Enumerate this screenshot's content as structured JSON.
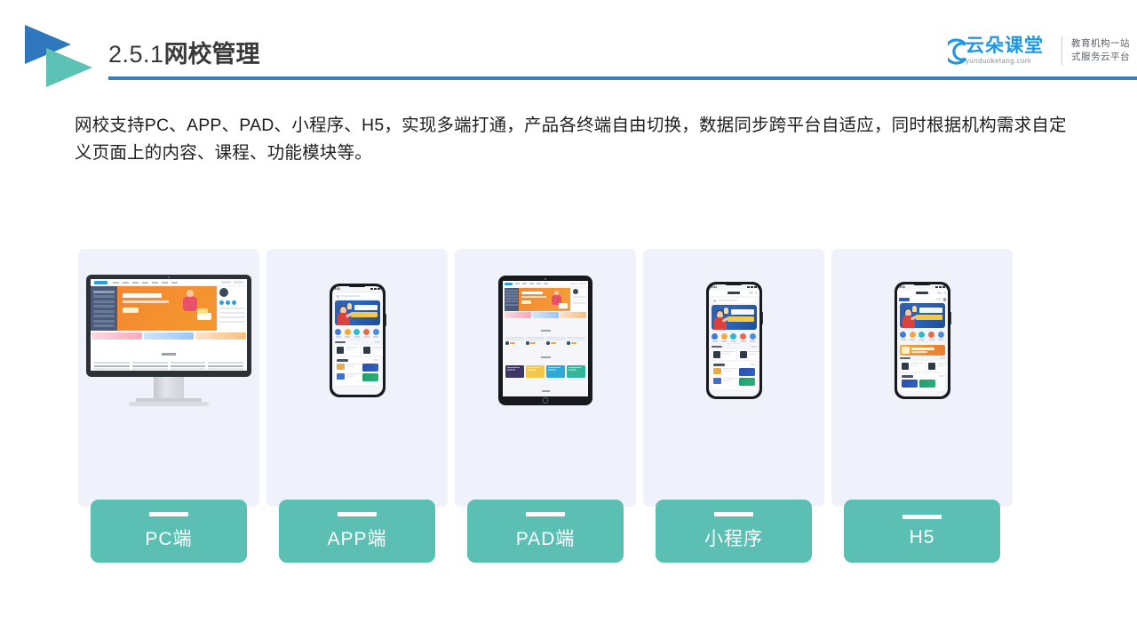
{
  "header": {
    "section_number": "2.5.1",
    "title": "网校管理",
    "accent_blue": "#3a7fc1",
    "logo_triangle_blue": "#2e76bd",
    "logo_triangle_teal": "#5cc2b5"
  },
  "brand": {
    "name_cn": "云朵课堂",
    "name_en": "yunduoketang.com",
    "tagline_line1": "教育机构一站",
    "tagline_line2": "式服务云平台",
    "color": "#2196e3"
  },
  "body": {
    "paragraph": "网校支持PC、APP、PAD、小程序、H5，实现多端打通，产品各终端自由切换，数据同步跨平台自适应，同时根据机构需求自定义页面上的内容、课程、功能模块等。"
  },
  "cards": {
    "label_bg": "#5bbfb4",
    "card_bg": "#eff2fa",
    "items": [
      {
        "label": "PC端",
        "device": "desktop-monitor"
      },
      {
        "label": "APP端",
        "device": "smartphone"
      },
      {
        "label": "PAD端",
        "device": "tablet"
      },
      {
        "label": "小程序",
        "device": "smartphone-miniprogram"
      },
      {
        "label": "H5",
        "device": "smartphone-browser"
      }
    ]
  }
}
